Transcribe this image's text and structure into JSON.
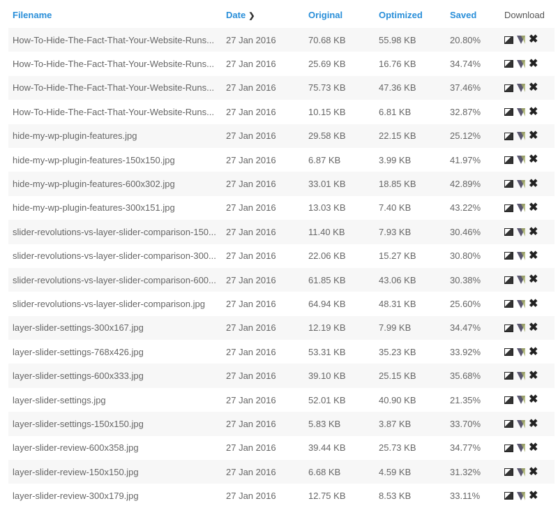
{
  "headers": {
    "filename": "Filename",
    "date": "Date",
    "original": "Original",
    "optimized": "Optimized",
    "saved": "Saved",
    "download": "Download"
  },
  "rows": [
    [
      "How-To-Hide-The-Fact-That-Your-Website-Runs...",
      "27 Jan 2016",
      "70.68 KB",
      "55.98 KB",
      "20.80%"
    ],
    [
      "How-To-Hide-The-Fact-That-Your-Website-Runs...",
      "27 Jan 2016",
      "25.69 KB",
      "16.76 KB",
      "34.74%"
    ],
    [
      "How-To-Hide-The-Fact-That-Your-Website-Runs...",
      "27 Jan 2016",
      "75.73 KB",
      "47.36 KB",
      "37.46%"
    ],
    [
      "How-To-Hide-The-Fact-That-Your-Website-Runs...",
      "27 Jan 2016",
      "10.15 KB",
      "6.81 KB",
      "32.87%"
    ],
    [
      "hide-my-wp-plugin-features.jpg",
      "27 Jan 2016",
      "29.58 KB",
      "22.15 KB",
      "25.12%"
    ],
    [
      "hide-my-wp-plugin-features-150x150.jpg",
      "27 Jan 2016",
      "6.87 KB",
      "3.99 KB",
      "41.97%"
    ],
    [
      "hide-my-wp-plugin-features-600x302.jpg",
      "27 Jan 2016",
      "33.01 KB",
      "18.85 KB",
      "42.89%"
    ],
    [
      "hide-my-wp-plugin-features-300x151.jpg",
      "27 Jan 2016",
      "13.03 KB",
      "7.40 KB",
      "43.22%"
    ],
    [
      "slider-revolutions-vs-layer-slider-comparison-150...",
      "27 Jan 2016",
      "11.40 KB",
      "7.93 KB",
      "30.46%"
    ],
    [
      "slider-revolutions-vs-layer-slider-comparison-300...",
      "27 Jan 2016",
      "22.06 KB",
      "15.27 KB",
      "30.80%"
    ],
    [
      "slider-revolutions-vs-layer-slider-comparison-600...",
      "27 Jan 2016",
      "61.85 KB",
      "43.06 KB",
      "30.38%"
    ],
    [
      "slider-revolutions-vs-layer-slider-comparison.jpg",
      "27 Jan 2016",
      "64.94 KB",
      "48.31 KB",
      "25.60%"
    ],
    [
      "layer-slider-settings-300x167.jpg",
      "27 Jan 2016",
      "12.19 KB",
      "7.99 KB",
      "34.47%"
    ],
    [
      "layer-slider-settings-768x426.jpg",
      "27 Jan 2016",
      "53.31 KB",
      "35.23 KB",
      "33.92%"
    ],
    [
      "layer-slider-settings-600x333.jpg",
      "27 Jan 2016",
      "39.10 KB",
      "25.15 KB",
      "35.68%"
    ],
    [
      "layer-slider-settings.jpg",
      "27 Jan 2016",
      "52.01 KB",
      "40.90 KB",
      "21.35%"
    ],
    [
      "layer-slider-settings-150x150.jpg",
      "27 Jan 2016",
      "5.83 KB",
      "3.87 KB",
      "33.70%"
    ],
    [
      "layer-slider-review-600x358.jpg",
      "27 Jan 2016",
      "39.44 KB",
      "25.73 KB",
      "34.77%"
    ],
    [
      "layer-slider-review-150x150.jpg",
      "27 Jan 2016",
      "6.68 KB",
      "4.59 KB",
      "31.32%"
    ],
    [
      "layer-slider-review-300x179.jpg",
      "27 Jan 2016",
      "12.75 KB",
      "8.53 KB",
      "33.11%"
    ]
  ]
}
